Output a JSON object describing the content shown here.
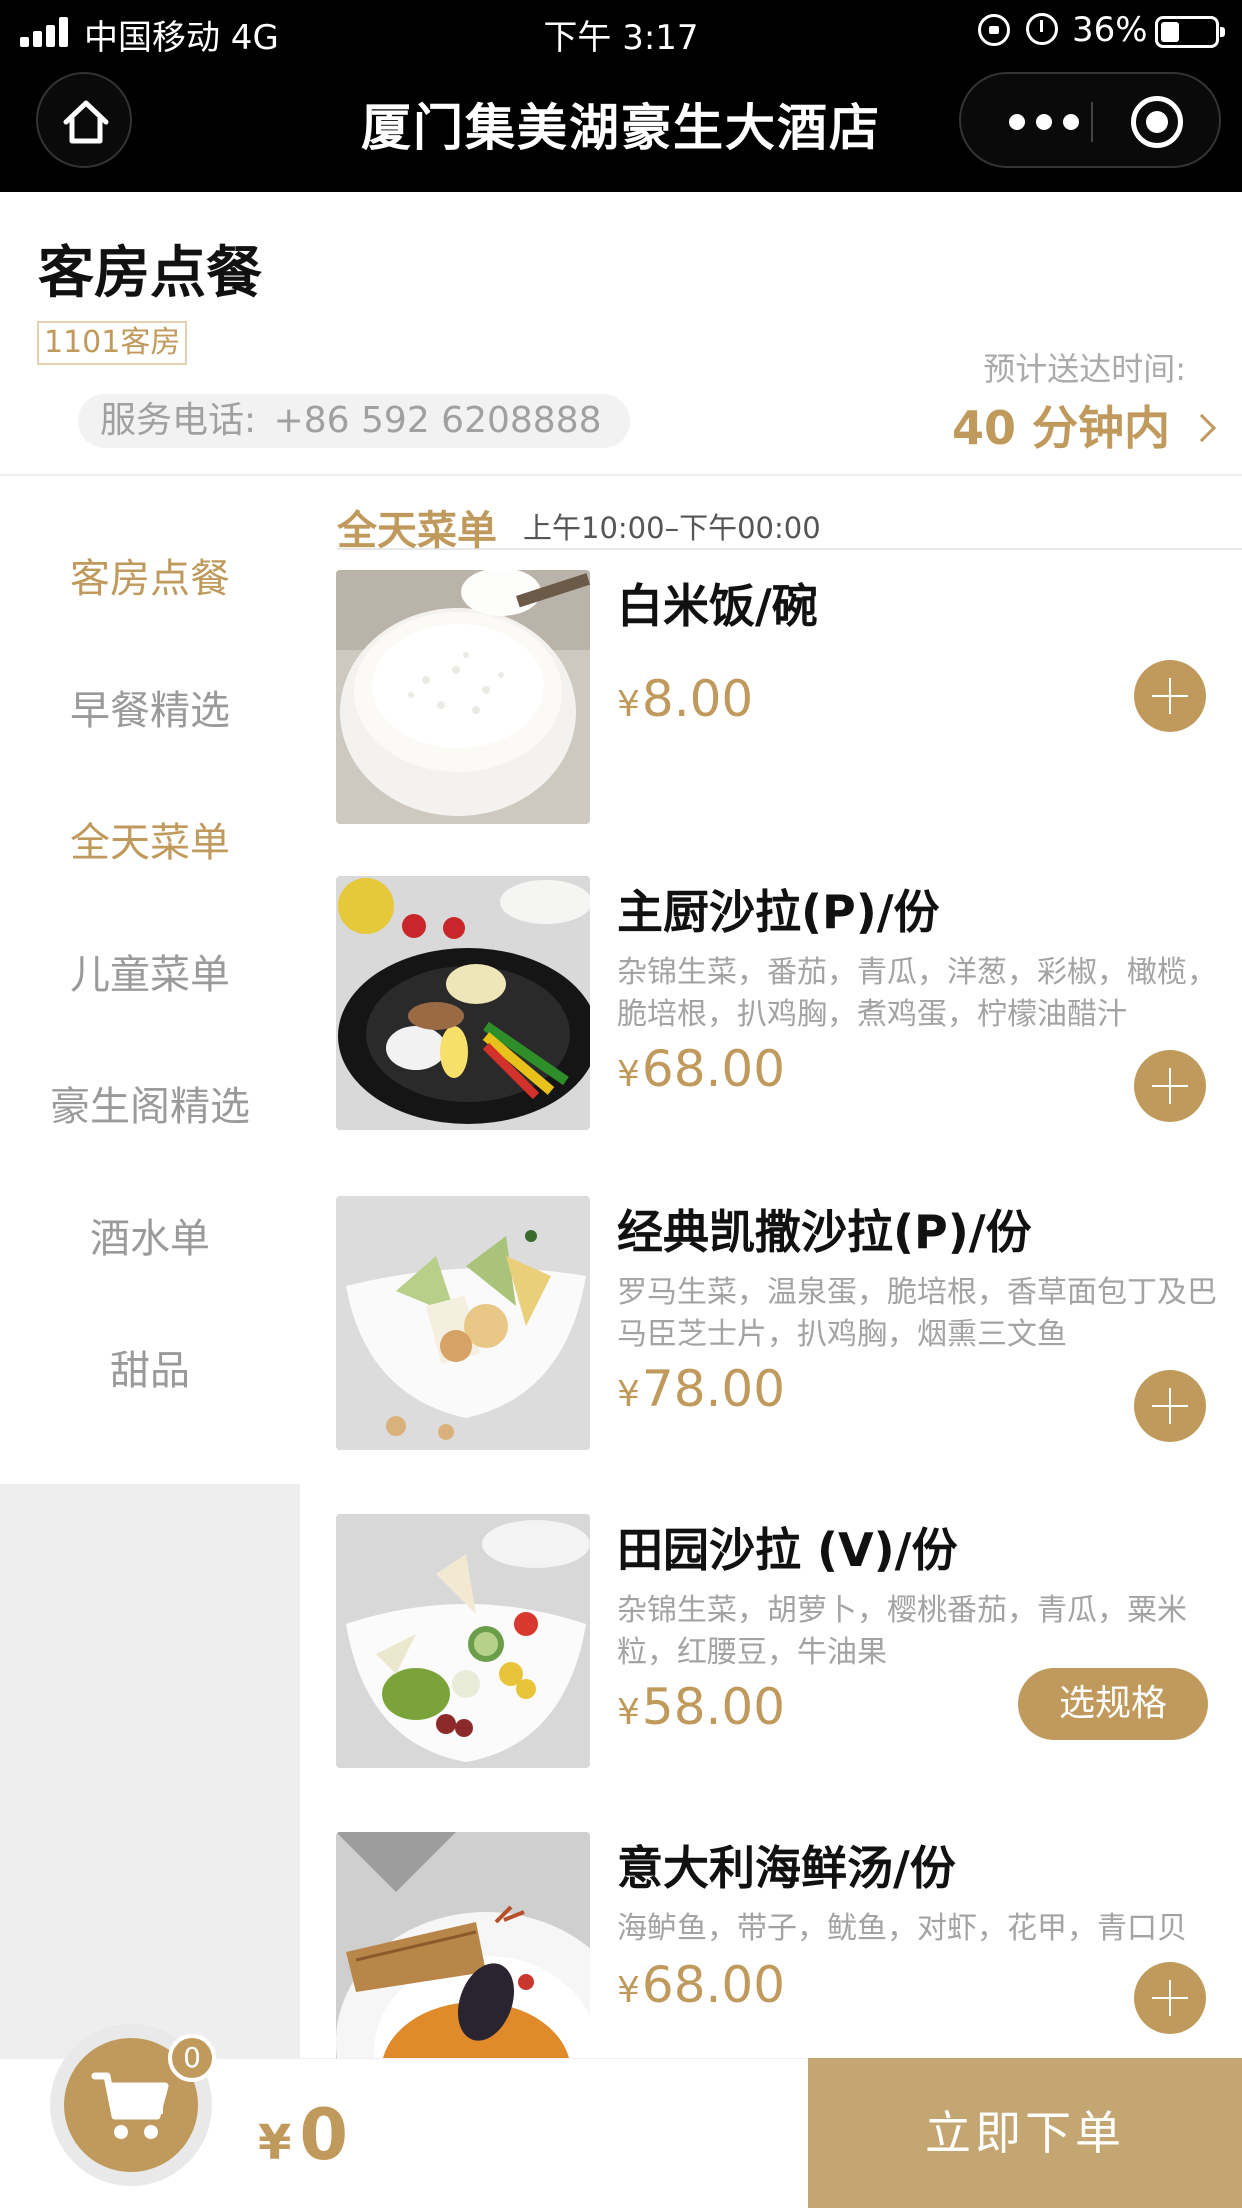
{
  "status_bar": {
    "carrier": "中国移动  4G",
    "time": "下午 3:17",
    "battery": "36%"
  },
  "nav": {
    "title": "厦门集美湖豪生大酒店"
  },
  "header": {
    "title": "客房点餐",
    "room": "1101客房",
    "phone_label": "服务电话:",
    "phone": "+86 592 6208888",
    "eta_label": "预计送达时间:",
    "eta": "40 分钟内"
  },
  "categories": [
    {
      "label": "客房点餐",
      "active": true
    },
    {
      "label": "早餐精选",
      "active": false
    },
    {
      "label": "全天菜单",
      "active": true
    },
    {
      "label": "儿童菜单",
      "active": false
    },
    {
      "label": "豪生阁精选",
      "active": false
    },
    {
      "label": "酒水单",
      "active": false
    },
    {
      "label": "甜品",
      "active": false
    }
  ],
  "section": {
    "title": "全天菜单",
    "hours": "上午10:00–下午00:00"
  },
  "items": [
    {
      "name": "白米饭/碗",
      "desc": "",
      "currency": "¥",
      "price": "8.00",
      "action": "add"
    },
    {
      "name": "主厨沙拉(P)/份",
      "desc": "杂锦生菜，番茄，青瓜，洋葱，彩椒，橄榄，脆培根，扒鸡胸，煮鸡蛋，柠檬油醋汁",
      "currency": "¥",
      "price": "68.00",
      "action": "add"
    },
    {
      "name": "经典凯撒沙拉(P)/份",
      "desc": "罗马生菜，温泉蛋，脆培根，香草面包丁及巴马臣芝士片，扒鸡胸，烟熏三文鱼",
      "currency": "¥",
      "price": "78.00",
      "action": "add"
    },
    {
      "name": "田园沙拉 (V)/份",
      "desc": "杂锦生菜，胡萝卜，樱桃番茄，青瓜，粟米粒，红腰豆，牛油果",
      "currency": "¥",
      "price": "58.00",
      "action": "spec",
      "action_label": "选规格"
    },
    {
      "name": "意大利海鲜汤/份",
      "desc": "海鲈鱼，带子，鱿鱼，对虾，花甲，青口贝",
      "currency": "¥",
      "price": "68.00",
      "action": "add"
    }
  ],
  "cart": {
    "count": "0",
    "currency": "¥",
    "total": "0",
    "order_label": "立即下单"
  },
  "colors": {
    "accent": "#bf9a5c",
    "order_button": "#c4a672"
  }
}
